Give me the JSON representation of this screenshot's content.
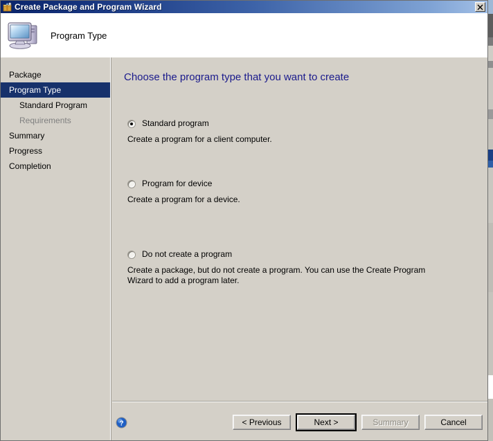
{
  "window": {
    "title": "Create Package and Program Wizard",
    "title_icon": "wizard-package-icon",
    "close_label": "×",
    "accent_titlebar_dark": "#0a246a",
    "accent_titlebar_light": "#a3c0e6",
    "face_color": "#d4d0c8"
  },
  "header": {
    "icon": "computer-icon",
    "title": "Program Type"
  },
  "sidebar": {
    "items": [
      {
        "label": "Package",
        "state": "normal",
        "level": 0
      },
      {
        "label": "Program Type",
        "state": "active",
        "level": 0
      },
      {
        "label": "Standard Program",
        "state": "normal",
        "level": 1
      },
      {
        "label": "Requirements",
        "state": "muted",
        "level": 1
      },
      {
        "label": "Summary",
        "state": "normal",
        "level": 0
      },
      {
        "label": "Progress",
        "state": "normal",
        "level": 0
      },
      {
        "label": "Completion",
        "state": "normal",
        "level": 0
      }
    ]
  },
  "main": {
    "heading": "Choose the program type that you want to create",
    "heading_color": "#1a1a8c",
    "options": [
      {
        "label": "Standard program",
        "description": "Create a program for a client computer.",
        "checked": true
      },
      {
        "label": "Program for device",
        "description": "Create a program for a device.",
        "checked": false
      },
      {
        "label": "Do not create a program",
        "description": "Create a package, but do not create a program. You can use the Create Program Wizard to add a program later.",
        "checked": false
      }
    ]
  },
  "footer": {
    "help_icon": "help-question-icon",
    "buttons": [
      {
        "label": "< Previous",
        "state": "enabled"
      },
      {
        "label": "Next >",
        "state": "default"
      },
      {
        "label": "Summary",
        "state": "disabled"
      },
      {
        "label": "Cancel",
        "state": "enabled"
      }
    ]
  }
}
